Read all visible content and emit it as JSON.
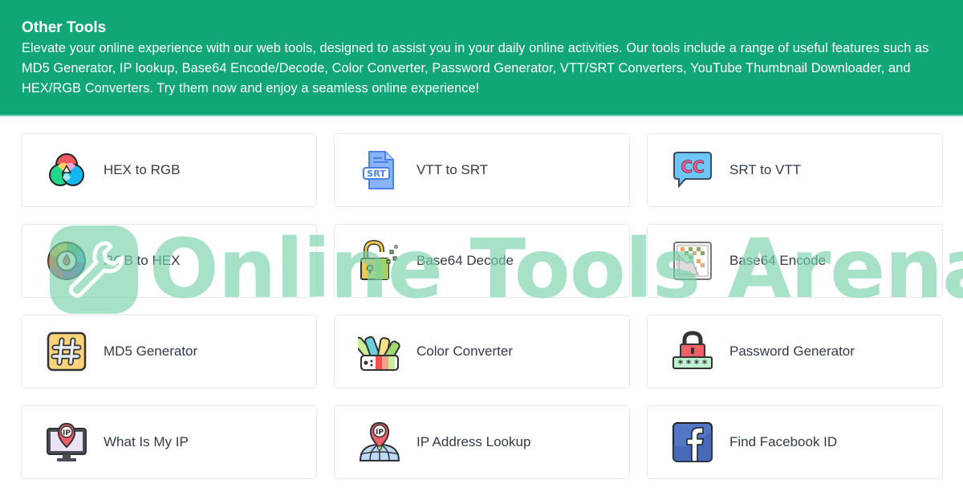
{
  "header": {
    "title": "Other Tools",
    "description": "Elevate your online experience with our web tools, designed to assist you in your daily online activities. Our tools include a range of useful features such as MD5 Generator, IP lookup, Base64 Encode/Decode, Color Converter, Password Generator, VTT/SRT Converters, YouTube Thumbnail Downloader, and HEX/RGB Converters. Try them now and enjoy a seamless online experience!",
    "background_color": "#10a677"
  },
  "tools": [
    {
      "label": "HEX to RGB",
      "icon": "color-circles-icon"
    },
    {
      "label": "VTT to SRT",
      "icon": "srt-file-icon"
    },
    {
      "label": "SRT to VTT",
      "icon": "cc-speech-bubble-icon"
    },
    {
      "label": "RGB to HEX",
      "icon": "color-wheel-icon"
    },
    {
      "label": "Base64 Decode",
      "icon": "unlocked-padlock-icon"
    },
    {
      "label": "Base64 Encode",
      "icon": "encoded-image-icon"
    },
    {
      "label": "MD5 Generator",
      "icon": "hash-icon"
    },
    {
      "label": "Color Converter",
      "icon": "color-swatch-fan-icon"
    },
    {
      "label": "Password Generator",
      "icon": "password-lock-icon"
    },
    {
      "label": "What Is My IP",
      "icon": "monitor-ip-pin-icon"
    },
    {
      "label": "IP Address Lookup",
      "icon": "globe-ip-pin-icon"
    },
    {
      "label": "Find Facebook ID",
      "icon": "facebook-icon"
    }
  ],
  "watermark": {
    "text": "Online Tools Arena",
    "icon": "wrench-icon"
  }
}
